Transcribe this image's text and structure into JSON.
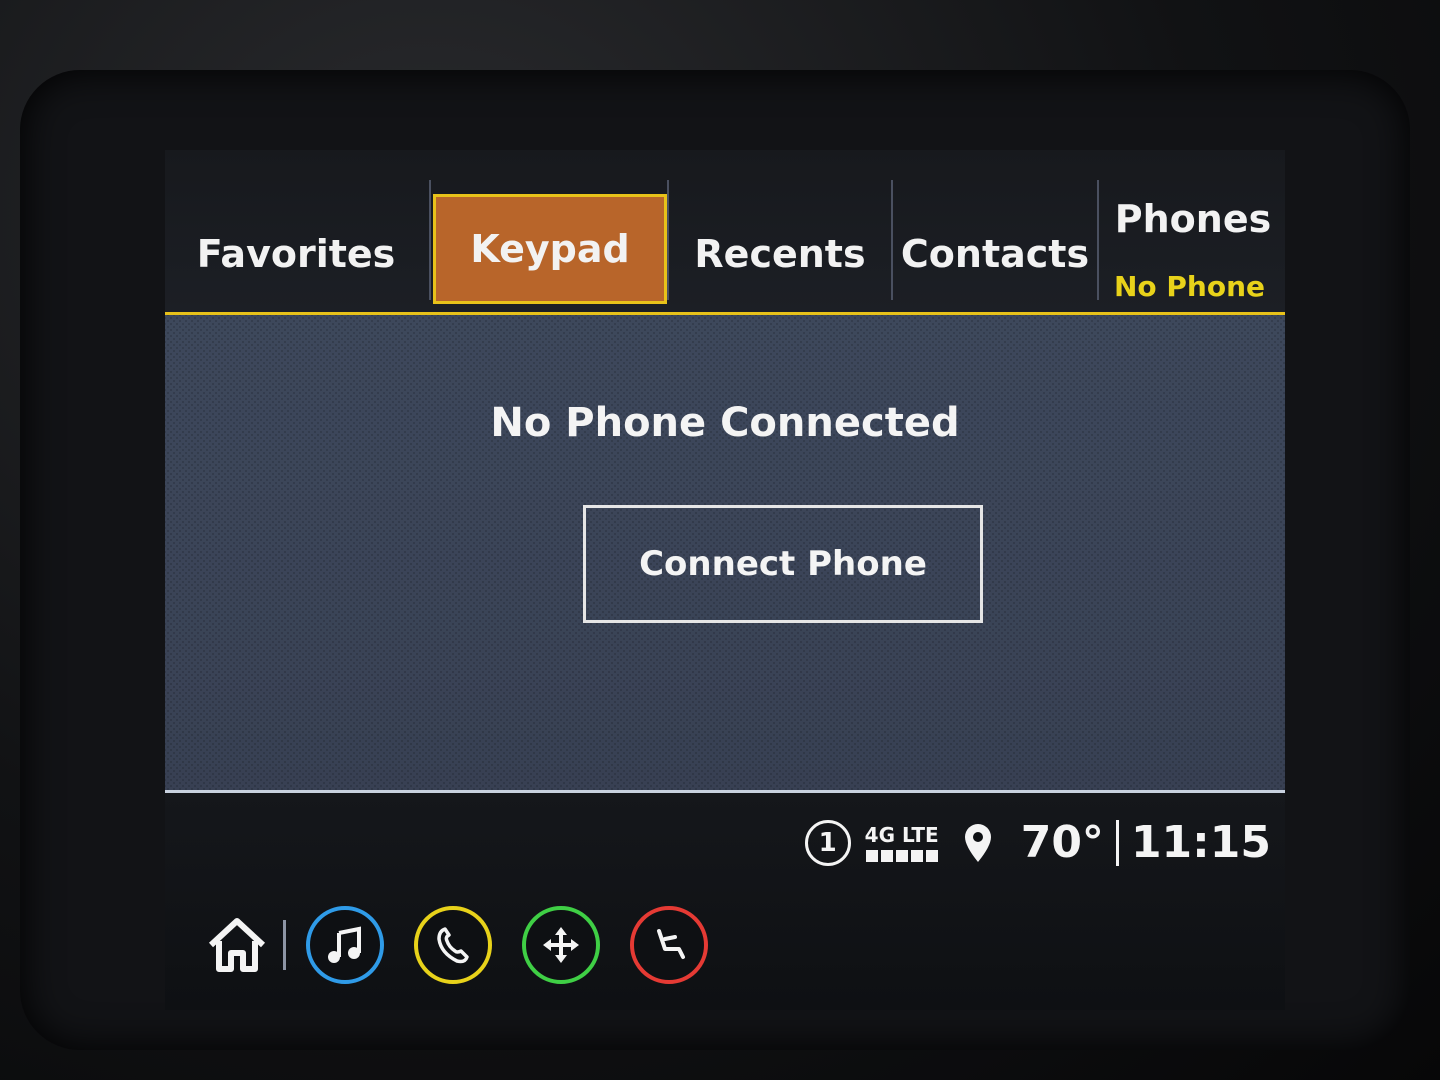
{
  "tabs": [
    {
      "label": "Favorites",
      "active": false
    },
    {
      "label": "Keypad",
      "active": true
    },
    {
      "label": "Recents",
      "active": false
    },
    {
      "label": "Contacts",
      "active": false
    },
    {
      "label": "Phones",
      "active": false
    }
  ],
  "phone_status_label": "No Phone",
  "main": {
    "message": "No Phone Connected",
    "connect_button_label": "Connect Phone"
  },
  "status": {
    "circle_number": "1",
    "network": "4G LTE",
    "signal_bars": 5,
    "temperature": "70°",
    "time": "11:15"
  },
  "dock": {
    "items": [
      {
        "icon": "home-icon"
      },
      {
        "icon": "music-icon",
        "color": "#2f9be8"
      },
      {
        "icon": "phone-icon",
        "color": "#e8d21a"
      },
      {
        "icon": "navigation-icon",
        "color": "#3fcf45"
      },
      {
        "icon": "climate-seat-icon",
        "color": "#e53a34"
      }
    ]
  },
  "colors": {
    "accent": "#e8c21a",
    "active_tab": "#b8652a",
    "screen_bg": "#3b4457"
  }
}
